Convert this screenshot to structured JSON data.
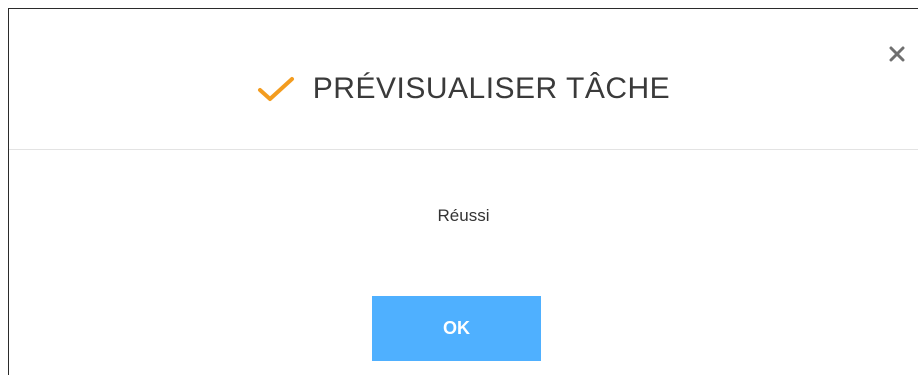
{
  "dialog": {
    "title": "PRÉVISUALISER TÂCHE",
    "message": "Réussi",
    "ok_label": "OK",
    "icons": {
      "status": "check-icon",
      "close": "close-icon"
    },
    "colors": {
      "accent": "#f39c1f",
      "button": "#4fb0ff",
      "close": "#707070"
    }
  }
}
